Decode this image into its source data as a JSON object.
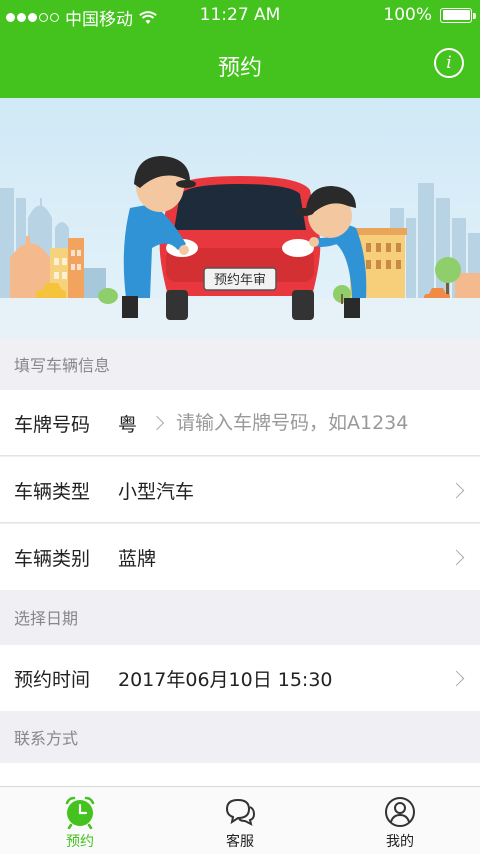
{
  "status_bar": {
    "carrier": "中国移动",
    "time": "11:27 AM",
    "battery": "100%",
    "battery_level": 1.0
  },
  "nav": {
    "title": "预约",
    "info_icon": "info-icon"
  },
  "banner": {
    "sign_text": "预约年审"
  },
  "sections": {
    "vehicle_info": "填写车辆信息",
    "select_date": "选择日期",
    "contact": "联系方式"
  },
  "form": {
    "plate": {
      "label": "车牌号码",
      "province": "粤",
      "placeholder": "请输入车牌号码，如A1234",
      "value": ""
    },
    "vehicle_type": {
      "label": "车辆类型",
      "value": "小型汽车"
    },
    "vehicle_category": {
      "label": "车辆类别",
      "value": "蓝牌"
    },
    "appointment_time": {
      "label": "预约时间",
      "value": "2017年06月10日 15:30"
    }
  },
  "tabbar": {
    "items": [
      {
        "label": "预约",
        "icon": "alarm-clock-icon",
        "active": true
      },
      {
        "label": "客服",
        "icon": "chat-bubbles-icon",
        "active": false
      },
      {
        "label": "我的",
        "icon": "user-icon",
        "active": false
      }
    ],
    "active_color": "#44c21e"
  },
  "colors": {
    "brand": "#44c21e",
    "background": "#efeff4"
  }
}
